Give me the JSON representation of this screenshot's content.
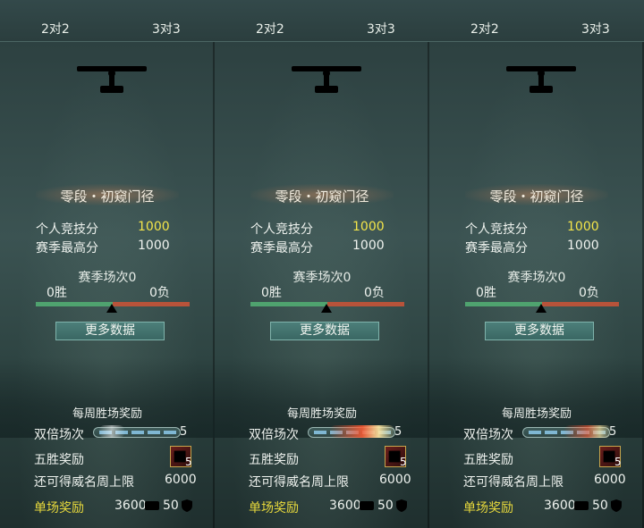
{
  "panels": [
    {
      "tabs": [
        "2对2",
        "3对3"
      ],
      "rank_title": "零段・初窥门径",
      "stats": {
        "score_label": "个人竞技分",
        "score": "1000",
        "best_label": "赛季最高分",
        "best": "1000"
      },
      "season": {
        "title": "赛季场次0",
        "wins": "0胜",
        "losses": "0负"
      },
      "more_button": "更多数据",
      "weekly": {
        "title": "每周胜场奖励",
        "double_label": "双倍场次",
        "double_count": "5",
        "five_win_label": "五胜奖励",
        "chest_count": "5",
        "cap_label": "还可得威名周上限",
        "cap_value": "6000"
      },
      "single": {
        "label": "单场奖励",
        "coins": "3600",
        "shields": "50"
      },
      "effect": "spark-left"
    },
    {
      "tabs": [
        "2对2",
        "3对3"
      ],
      "rank_title": "零段・初窥门径",
      "stats": {
        "score_label": "个人竞技分",
        "score": "1000",
        "best_label": "赛季最高分",
        "best": "1000"
      },
      "season": {
        "title": "赛季场次0",
        "wins": "0胜",
        "losses": "0负"
      },
      "more_button": "更多数据",
      "weekly": {
        "title": "每周胜场奖励",
        "double_label": "双倍场次",
        "double_count": "5",
        "five_win_label": "五胜奖励",
        "chest_count": "5",
        "cap_label": "还可得威名周上限",
        "cap_value": "6000"
      },
      "single": {
        "label": "单场奖励",
        "coins": "3600",
        "shields": "50"
      },
      "effect": "flare-middle"
    },
    {
      "tabs": [
        "2对2",
        "3对3"
      ],
      "rank_title": "零段・初窥门径",
      "stats": {
        "score_label": "个人竞技分",
        "score": "1000",
        "best_label": "赛季最高分",
        "best": "1000"
      },
      "season": {
        "title": "赛季场次0",
        "wins": "0胜",
        "losses": "0负"
      },
      "more_button": "更多数据",
      "weekly": {
        "title": "每周胜场奖励",
        "double_label": "双倍场次",
        "double_count": "5",
        "five_win_label": "五胜奖励",
        "chest_count": "5",
        "cap_label": "还可得威名周上限",
        "cap_value": "6000"
      },
      "single": {
        "label": "单场奖励",
        "coins": "3600",
        "shields": "50"
      },
      "effect": "flare-right"
    }
  ],
  "colors": {
    "score_yellow": "#f3e54a",
    "win_green": "#4fa36f",
    "loss_red": "#b8533a",
    "single_label": "#e7d93c"
  }
}
